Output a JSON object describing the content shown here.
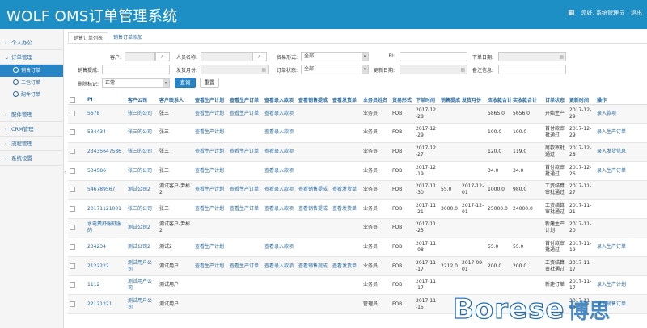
{
  "header": {
    "title": "WOLF OMS订单管理系统",
    "welcome": "您好, 系统管理员",
    "logout": "退出"
  },
  "sidebar": {
    "items": [
      {
        "label": "个人办公",
        "expanded": false
      },
      {
        "label": "订单管理",
        "expanded": true,
        "children": [
          "销售订单",
          "三包订单",
          "配件订单"
        ],
        "active_child": 0
      },
      {
        "label": "配件管理",
        "expanded": false
      },
      {
        "label": "CRM管理",
        "expanded": false
      },
      {
        "label": "流程管理",
        "expanded": false
      },
      {
        "label": "系统设置",
        "expanded": false
      }
    ]
  },
  "tabs": [
    "销售订单列表",
    "销售订单添加"
  ],
  "form": {
    "customer_label": "客户:",
    "staff_label": "人员名称:",
    "trade_label": "贸易形式:",
    "trade_value": "全部",
    "pi_label": "PI:",
    "order_date_label": "下单日期:",
    "sales_name_label": "销售提成:",
    "ship_month_label": "发货月份:",
    "status_label": "订单状态:",
    "status_value": "全部",
    "update_label": "更新日期:",
    "remark_label": "备注信息:",
    "delete_label": "删除标记:",
    "delete_value": "正常",
    "query_button": "查询",
    "reset_button": "重置"
  },
  "table": {
    "headers": [
      "PI",
      "客户公司",
      "客户联系人",
      "查看生产计划",
      "查看生产订单",
      "查看录入款项",
      "查看销售提成",
      "查看发货单",
      "业务员姓名",
      "贸易形式",
      "下单时间",
      "销售提成",
      "发货月份",
      "应收款合计",
      "实收款合计",
      "订单状态",
      "更新时间",
      "操作"
    ],
    "rows": [
      [
        "5678",
        "张三的公司",
        "张三",
        "查看生产计划",
        "查看生产订单",
        "查看录入款项",
        "",
        "",
        "业务员",
        "FOB",
        "2017-12-28",
        "",
        "",
        "5865.0",
        "5656.0",
        "开始生产",
        "2017-12-29",
        "录入款项"
      ],
      [
        "534434",
        "张三的公司",
        "张三",
        "查看生产计划",
        "",
        "查看录入款项",
        "",
        "",
        "业务员",
        "FOB",
        "2017-12-29",
        "",
        "",
        "100.0",
        "100.0",
        "首付款审批通过",
        "2017-12-29",
        "录入生产订单"
      ],
      [
        "23435647586",
        "张三的公司",
        "张三",
        "查看生产计划",
        "查看生产订单",
        "查看录入款项",
        "",
        "",
        "业务员",
        "FOB",
        "2017-12-27",
        "",
        "",
        "120.0",
        "119.0",
        "尾款审批通过",
        "2017-12-28",
        "录入发货信息"
      ],
      [
        "534586",
        "张三的公司",
        "张三",
        "查看生产计划",
        "",
        "查看录入款项",
        "",
        "",
        "业务员",
        "FOB",
        "2017-12-19",
        "",
        "",
        "34.0",
        "34.0",
        "首付款审批通过",
        "2017-12-26",
        "录入生产订单"
      ],
      [
        "546789567",
        "测试公司2",
        "测试客户-尹彬2",
        "查看生产计划",
        "查看生产订单",
        "查看录入款项",
        "查看销售提成",
        "查看发货单",
        "业务员",
        "FOB",
        "2017-11-30",
        "55.0",
        "2017-12-01",
        "1000.0",
        "980.0",
        "工资结算审批通过",
        "2017-11-27",
        ""
      ],
      [
        "20171121001",
        "张三的公司",
        "张三",
        "查看生产计划",
        "查看生产订单",
        "查看录入款项",
        "查看销售提成",
        "查看发货单",
        "业务员",
        "FOB",
        "2017-11-21",
        "3000.0",
        "2017-12-01",
        "25000.0",
        "24000.0",
        "工资结算审批通过",
        "2017-11-21",
        ""
      ],
      [
        "水电费舒服舒服的",
        "测试公司2",
        "测试客户-尹彬2",
        "",
        "",
        "",
        "",
        "",
        "业务员",
        "FOB",
        "2017-11-23",
        "",
        "",
        "",
        "",
        "新建生产计划",
        "2017-11-20",
        ""
      ],
      [
        "234234",
        "测试公司2",
        "测试2",
        "查看生产计划",
        "",
        "查看录入款项",
        "",
        "",
        "业务员",
        "FOB",
        "2017-11-08",
        "",
        "",
        "55.0",
        "55.0",
        "首付款审批通过",
        "2017-11-19",
        "录入生产订单"
      ],
      [
        "2122222",
        "测试用户公司",
        "测试用户",
        "查看生产计划",
        "查看生产订单",
        "查看录入款项",
        "查看销售提成",
        "查看发货单",
        "业务员",
        "FOB",
        "2017-11-17",
        "2212.0",
        "2017-09-01",
        "200.0",
        "200.0",
        "工资结算审批通过",
        "2017-11-17",
        ""
      ],
      [
        "1112",
        "测试用户公司",
        "测试用户",
        "",
        "",
        "",
        "",
        "",
        "业务员",
        "FOB",
        "2017-11-17",
        "",
        "",
        "",
        "",
        "新建订单",
        "2017-11-17",
        "录入生产计划"
      ],
      [
        "22121221",
        "测试用户公司",
        "测试用户",
        "",
        "",
        "",
        "",
        "",
        "管理员",
        "FOB",
        "2017-11-15",
        "",
        "",
        "",
        "",
        "",
        "2017-11-15",
        "录入销售订单"
      ]
    ]
  },
  "watermark": {
    "latin": "Borese",
    "cn": "博思"
  },
  "colors": {
    "header": "#1e8fc4",
    "link": "#2a6a9e",
    "primary": "#2785c6"
  }
}
